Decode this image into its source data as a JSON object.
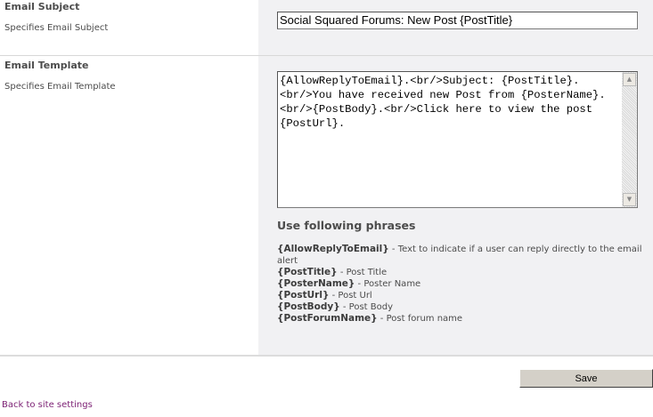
{
  "email_subject": {
    "title": "Email Subject",
    "description": "Specifies Email Subject",
    "value": "Social Squared Forums: New Post {PostTitle}"
  },
  "email_template": {
    "title": "Email Template",
    "description": "Specifies Email Template",
    "value": "{AllowReplyToEmail}.<br/>Subject: {PostTitle}.<br/>You have received new Post from {PosterName}.<br/>{PostBody}.<br/>Click here to view the post {PostUrl}."
  },
  "phrases": {
    "heading": "Use following phrases",
    "items": [
      {
        "token": "{AllowReplyToEmail}",
        "desc": " - Text to indicate if a user can reply directly to the email alert"
      },
      {
        "token": "{PostTitle}",
        "desc": " - Post Title"
      },
      {
        "token": "{PosterName}",
        "desc": " - Poster Name"
      },
      {
        "token": "{PostUrl}",
        "desc": " - Post Url"
      },
      {
        "token": "{PostBody}",
        "desc": " - Post Body"
      },
      {
        "token": "{PostForumName}",
        "desc": " - Post forum name"
      }
    ]
  },
  "actions": {
    "save_label": "Save",
    "back_link": "Back to site settings"
  }
}
